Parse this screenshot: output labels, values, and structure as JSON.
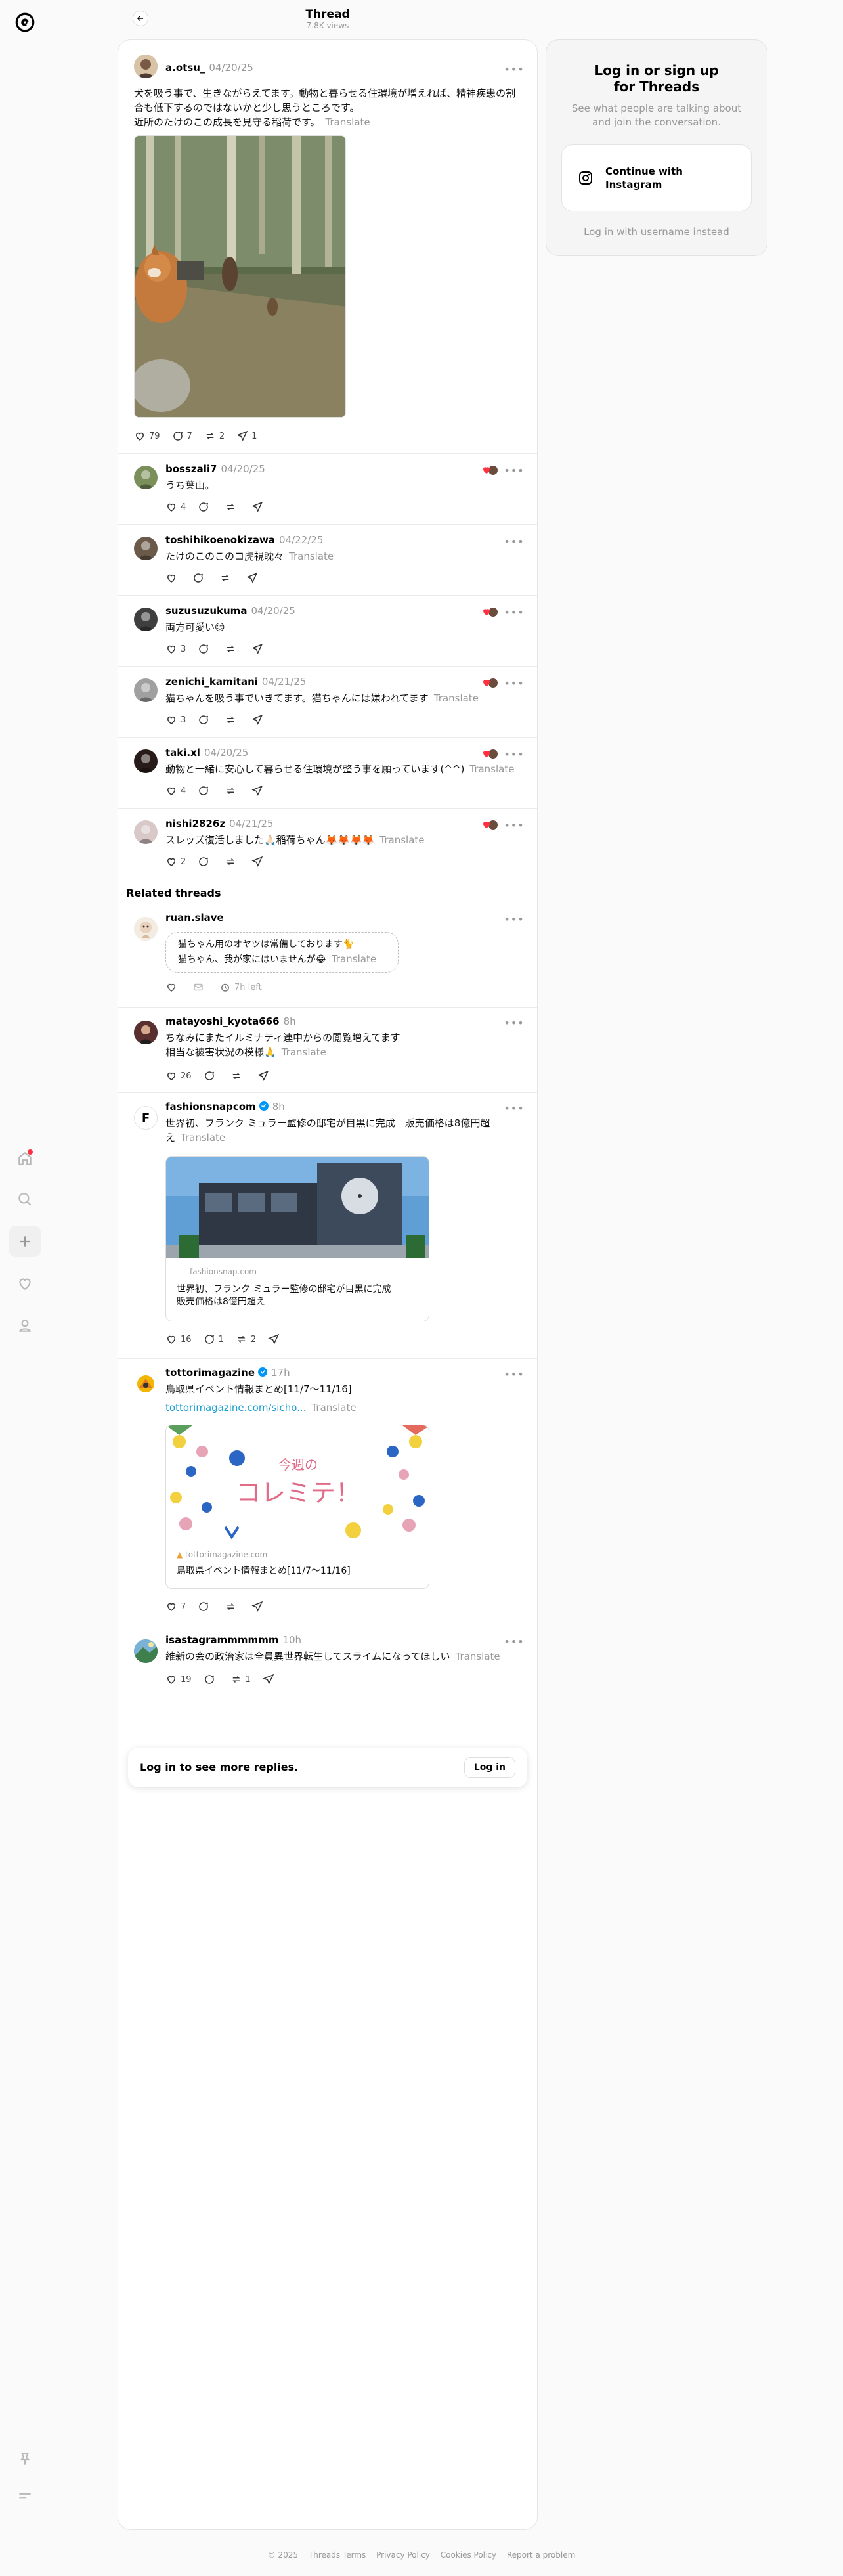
{
  "header": {
    "title": "Thread",
    "views": "7.8K views"
  },
  "main_post": {
    "username": "a.otsu_",
    "date": "04/20/25",
    "text_line1": "犬を吸う事で、生きながらえてます。動物と暮らせる住環境が増えれば、精神疾患の割",
    "text_line2": "合も低下するのではないかと少し思うところです。",
    "text_line3": "近所のたけのこの成長を見守る稲荷です。",
    "translate": "Translate",
    "likes": "79",
    "replies": "7",
    "reposts": "2",
    "shares": "1"
  },
  "replies": [
    {
      "username": "bosszali7",
      "date": "04/20/25",
      "text": "うち葉山。",
      "translate": "",
      "likes": "4",
      "replies": "",
      "reposts": "",
      "shares": "",
      "badge": true
    },
    {
      "username": "toshihikoenokizawa",
      "date": "04/22/25",
      "text": "たけのこのこのコ虎視眈々",
      "translate": "Translate",
      "likes": "",
      "replies": "",
      "reposts": "",
      "shares": "",
      "badge": false
    },
    {
      "username": "suzusuzukuma",
      "date": "04/20/25",
      "text": "両方可愛い😊",
      "translate": "",
      "likes": "3",
      "replies": "",
      "reposts": "",
      "shares": "",
      "badge": true
    },
    {
      "username": "zenichi_kamitani",
      "date": "04/21/25",
      "text": "猫ちゃんを吸う事でいきてます。猫ちゃんには嫌われてます",
      "translate": "Translate",
      "likes": "3",
      "replies": "",
      "reposts": "",
      "shares": "",
      "badge": true
    },
    {
      "username": "taki.xl",
      "date": "04/20/25",
      "text": "動物と一緒に安心して暮らせる住環境が整う事を願っています(^^)",
      "translate": "Translate",
      "likes": "4",
      "replies": "",
      "reposts": "",
      "shares": "",
      "badge": true
    },
    {
      "username": "nishi2826z",
      "date": "04/21/25",
      "text": "スレッズ復活しました🙏🏻稲荷ちゃん🦊🦊🦊🦊",
      "translate": "Translate",
      "likes": "2",
      "replies": "",
      "reposts": "",
      "shares": "",
      "badge": true
    }
  ],
  "related": {
    "title": "Related threads",
    "ruan": {
      "username": "ruan.slave",
      "line1": "猫ちゃん用のオヤツは常備しております🐈",
      "line2": "猫ちゃん、我が家にはいませんが😂",
      "translate": "Translate",
      "time_left": "7h left"
    },
    "matayoshi": {
      "username": "matayoshi_kyota666",
      "date": "8h",
      "line1": "ちなみにまたイルミナティ連中からの閲覧増えてます",
      "line2": "相当な被害状況の模様🙏",
      "translate": "Translate",
      "likes": "26"
    },
    "fashion": {
      "username": "fashionsnapcom",
      "date": "8h",
      "line1": "世界初、フランク ミュラー監修の邸宅が目黒に完成　販売価格は8億円超",
      "line2": "え",
      "translate": "Translate",
      "card_domain": "fashionsnap.com",
      "card_title1": "世界初、フランク ミュラー監修の邸宅が目黒に完成",
      "card_title2": "販売価格は8億円超え",
      "likes": "16",
      "replies": "1",
      "reposts": "2",
      "avatar_letter": "F"
    },
    "tottori": {
      "username": "tottorimagazine",
      "date": "17h",
      "line1": "鳥取県イベント情報まとめ[11/7〜11/16]",
      "link": "tottorimagazine.com/sicho...",
      "translate": "Translate",
      "card_small": "今週の",
      "card_big": "コレミテ！",
      "card_domain": "tottorimagazine.com",
      "card_title": "鳥取県イベント情報まとめ[11/7〜11/16]",
      "likes": "7"
    },
    "isa": {
      "username": "isastagrammmmmm",
      "date": "10h",
      "line1": "維新の会の政治家は全員異世界転生してスライムになってほしい",
      "translate": "Translate",
      "likes": "19",
      "reposts": "1"
    }
  },
  "login_bar": {
    "text": "Log in to see more replies.",
    "button": "Log in"
  },
  "login_panel": {
    "title_line1": "Log in or sign up",
    "title_line2": "for Threads",
    "sub_line1": "See what people are talking about",
    "sub_line2": "and join the conversation.",
    "button": "Continue with Instagram",
    "alt": "Log in with username instead"
  },
  "footer": [
    "© 2025",
    "Threads Terms",
    "Privacy Policy",
    "Cookies Policy",
    "Report a problem"
  ],
  "colors": {
    "verified": "#0095f6",
    "notification": "#ff3040",
    "muted": "#999999",
    "link": "#1a9fd1"
  },
  "icons": [
    "threads-logo-icon",
    "home-icon",
    "search-icon",
    "plus-icon",
    "heart-icon",
    "profile-icon",
    "pin-icon",
    "menu-icon",
    "back-arrow-icon",
    "more-icon",
    "reply-icon",
    "repost-icon",
    "share-icon",
    "instagram-icon",
    "verified-icon",
    "timer-icon"
  ]
}
